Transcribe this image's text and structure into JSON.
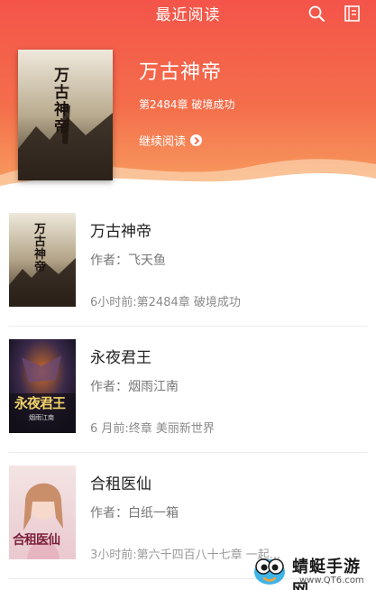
{
  "header": {
    "title": "最近阅读",
    "search_icon": "search-icon",
    "shelf_icon": "bookshelf-icon"
  },
  "featured": {
    "title": "万古神帝",
    "chapter": "第2484章 破境成功",
    "continue_label": "继续阅读",
    "cover_text": "万古神帝"
  },
  "books": [
    {
      "title": "万古神帝",
      "author": "作者：飞天鱼",
      "update": "6小时前:第2484章 破境成功",
      "cover_text": "万古神帝"
    },
    {
      "title": "永夜君王",
      "author": "作者：烟雨江南",
      "update": "6 月前:终章 美丽新世界",
      "cover_text": "永夜君王",
      "cover_subtext": "烟雨江南"
    },
    {
      "title": "合租医仙",
      "author": "作者：白纸一箱",
      "update": "3小时前:第六千四百八十七章 一起...",
      "cover_text": "合租医仙"
    }
  ],
  "watermark": {
    "name": "蜻蜓手游网",
    "url": "www.QT6.com"
  },
  "colors": {
    "header_top": "#f4544a",
    "header_bottom": "#f8a061",
    "accent": "#f46e4b"
  }
}
